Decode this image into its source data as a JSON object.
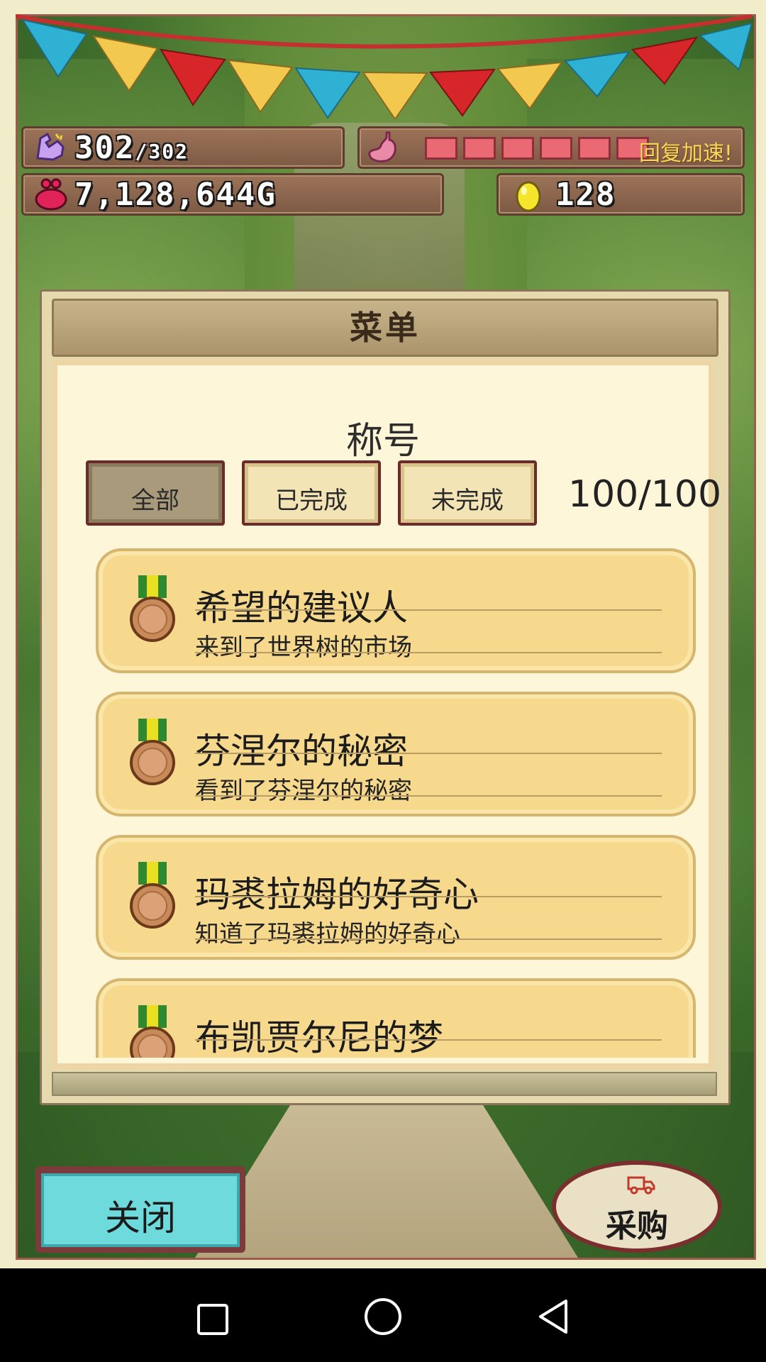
{
  "stats": {
    "stamina_current": "302",
    "stamina_max": "/302",
    "gold": "7,128,644G",
    "eggs": "128",
    "recover_label": "回复加速!"
  },
  "menu": {
    "title": "菜单",
    "section": "称号",
    "filters": [
      "全部",
      "已完成",
      "未完成"
    ],
    "active_filter": "全部",
    "count": "100/100",
    "titles": [
      {
        "name": "希望的建议人",
        "desc": "来到了世界树的市场"
      },
      {
        "name": "芬涅尔的秘密",
        "desc": "看到了芬涅尔的秘密"
      },
      {
        "name": "玛裘拉姆的好奇心",
        "desc": "知道了玛裘拉姆的好奇心"
      },
      {
        "name": "布凯贾尔尼的梦",
        "desc": ""
      }
    ]
  },
  "buttons": {
    "close": "关闭",
    "buy": "采购"
  },
  "icons": {
    "stamina": "flexed-arm-icon",
    "stomach": "stomach-icon",
    "gold": "purse-icon",
    "egg": "golden-egg-icon",
    "medal": "bronze-medal-icon",
    "truck": "truck-icon"
  },
  "colors": {
    "close_button": "#6fdadb",
    "entry_bg": "#f7d98e",
    "stomach_cell": "#e96a72"
  }
}
